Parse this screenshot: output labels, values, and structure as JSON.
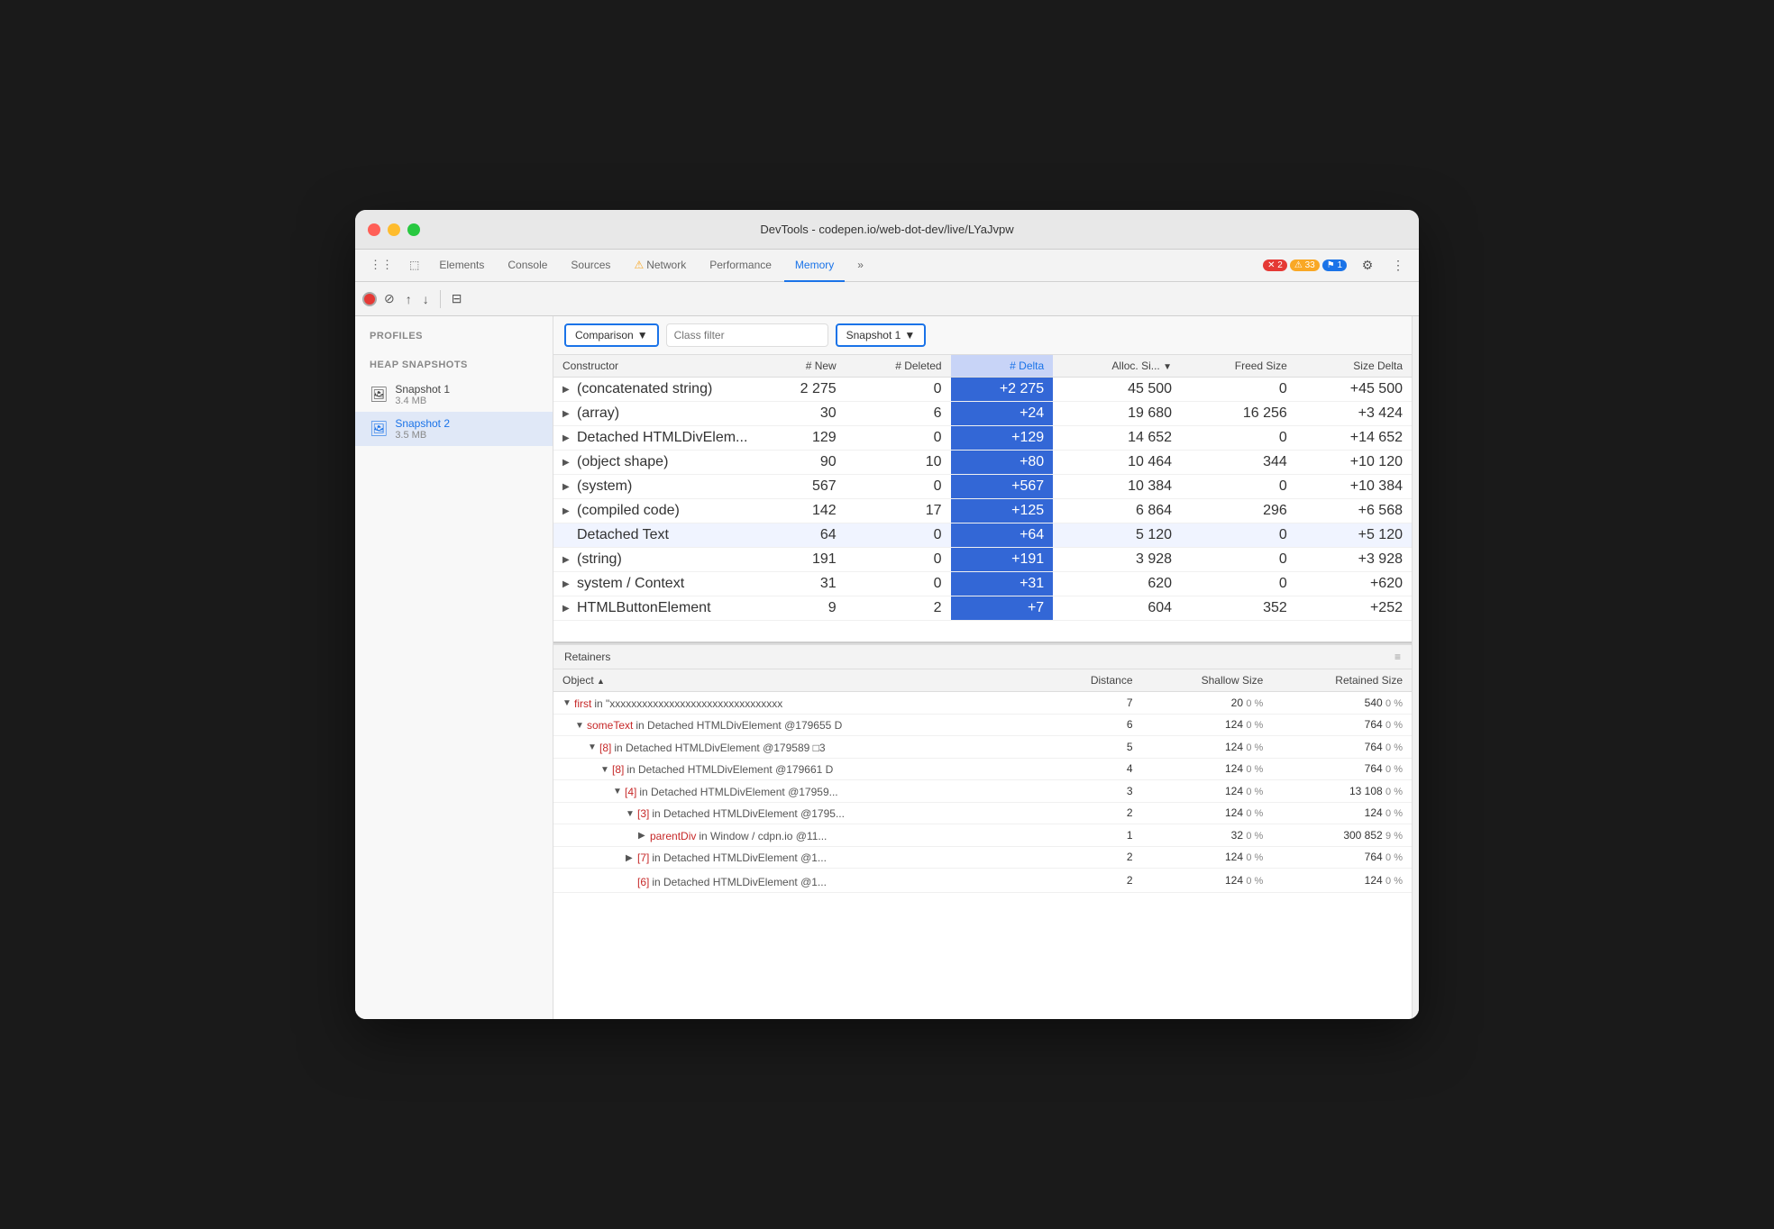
{
  "window": {
    "title": "DevTools - codepen.io/web-dot-dev/live/LYaJvpw"
  },
  "tabs": [
    {
      "label": "Elements",
      "icon": "",
      "active": false
    },
    {
      "label": "Console",
      "icon": "",
      "active": false
    },
    {
      "label": "Sources",
      "icon": "",
      "active": false
    },
    {
      "label": "Network",
      "icon": "⚠",
      "active": false
    },
    {
      "label": "Performance",
      "icon": "",
      "active": false
    },
    {
      "label": "Memory",
      "icon": "",
      "active": true
    },
    {
      "label": "»",
      "icon": "",
      "active": false
    }
  ],
  "badges": {
    "errors": "2",
    "warnings": "33",
    "info": "1"
  },
  "comparison_toolbar": {
    "mode_label": "Comparison",
    "filter_placeholder": "Class filter",
    "snapshot_label": "Snapshot 1"
  },
  "table_headers": {
    "constructor": "Constructor",
    "new": "# New",
    "deleted": "# Deleted",
    "delta": "# Delta",
    "alloc_size": "Alloc. Si...",
    "freed_size": "Freed Size",
    "size_delta": "Size Delta"
  },
  "table_rows": [
    {
      "constructor": "(concatenated string)",
      "new": "2 275",
      "deleted": "0",
      "delta": "+2 275",
      "alloc_size": "45 500",
      "freed_size": "0",
      "size_delta": "+45 500",
      "expandable": true
    },
    {
      "constructor": "(array)",
      "new": "30",
      "deleted": "6",
      "delta": "+24",
      "alloc_size": "19 680",
      "freed_size": "16 256",
      "size_delta": "+3 424",
      "expandable": true
    },
    {
      "constructor": "Detached HTMLDivElem...",
      "new": "129",
      "deleted": "0",
      "delta": "+129",
      "alloc_size": "14 652",
      "freed_size": "0",
      "size_delta": "+14 652",
      "expandable": true
    },
    {
      "constructor": "(object shape)",
      "new": "90",
      "deleted": "10",
      "delta": "+80",
      "alloc_size": "10 464",
      "freed_size": "344",
      "size_delta": "+10 120",
      "expandable": true
    },
    {
      "constructor": "(system)",
      "new": "567",
      "deleted": "0",
      "delta": "+567",
      "alloc_size": "10 384",
      "freed_size": "0",
      "size_delta": "+10 384",
      "expandable": true
    },
    {
      "constructor": "(compiled code)",
      "new": "142",
      "deleted": "17",
      "delta": "+125",
      "alloc_size": "6 864",
      "freed_size": "296",
      "size_delta": "+6 568",
      "expandable": true
    },
    {
      "constructor": "Detached Text",
      "new": "64",
      "deleted": "0",
      "delta": "+64",
      "alloc_size": "5 120",
      "freed_size": "0",
      "size_delta": "+5 120",
      "expandable": false
    },
    {
      "constructor": "(string)",
      "new": "191",
      "deleted": "0",
      "delta": "+191",
      "alloc_size": "3 928",
      "freed_size": "0",
      "size_delta": "+3 928",
      "expandable": true
    },
    {
      "constructor": "system / Context",
      "new": "31",
      "deleted": "0",
      "delta": "+31",
      "alloc_size": "620",
      "freed_size": "0",
      "size_delta": "+620",
      "expandable": true
    },
    {
      "constructor": "HTMLButtonElement",
      "new": "9",
      "deleted": "2",
      "delta": "+7",
      "alloc_size": "604",
      "freed_size": "352",
      "size_delta": "+252",
      "expandable": true
    }
  ],
  "retainers": {
    "header": "Retainers",
    "columns": {
      "object": "Object",
      "distance": "Distance",
      "shallow_size": "Shallow Size",
      "retained_size": "Retained Size"
    },
    "rows": [
      {
        "indent": 0,
        "prefix": "▼",
        "object_text": "first",
        "object_suffix": " in \"xxxxxxxxxxxxxxxxxxxxxxxxxxxxxxxx",
        "object_color": "red",
        "distance": "7",
        "shallow_size": "20",
        "shallow_pct": "0 %",
        "retained_size": "540",
        "retained_pct": "0 %"
      },
      {
        "indent": 1,
        "prefix": "▼",
        "object_text": "someText",
        "object_suffix": " in Detached HTMLDivElement @179655 D",
        "object_color": "red",
        "distance": "6",
        "shallow_size": "124",
        "shallow_pct": "0 %",
        "retained_size": "764",
        "retained_pct": "0 %"
      },
      {
        "indent": 2,
        "prefix": "▼",
        "object_text": "[8]",
        "object_suffix": " in Detached HTMLDivElement @179589 □3",
        "object_color": "red",
        "distance": "5",
        "shallow_size": "124",
        "shallow_pct": "0 %",
        "retained_size": "764",
        "retained_pct": "0 %"
      },
      {
        "indent": 3,
        "prefix": "▼",
        "object_text": "[8]",
        "object_suffix": " in Detached HTMLDivElement @179661 D",
        "object_color": "red",
        "distance": "4",
        "shallow_size": "124",
        "shallow_pct": "0 %",
        "retained_size": "764",
        "retained_pct": "0 %"
      },
      {
        "indent": 4,
        "prefix": "▼",
        "object_text": "[4]",
        "object_suffix": " in Detached HTMLDivElement @17959...",
        "object_color": "red",
        "distance": "3",
        "shallow_size": "124",
        "shallow_pct": "0 %",
        "retained_size": "13 108",
        "retained_pct": "0 %"
      },
      {
        "indent": 5,
        "prefix": "▼",
        "object_text": "[3]",
        "object_suffix": " in Detached HTMLDivElement @1795...",
        "object_color": "red",
        "distance": "2",
        "shallow_size": "124",
        "shallow_pct": "0 %",
        "retained_size": "124",
        "retained_pct": "0 %"
      },
      {
        "indent": 6,
        "prefix": "▶",
        "object_text": "parentDiv",
        "object_suffix": " in Window / cdpn.io @11...",
        "object_color": "red",
        "distance": "1",
        "shallow_size": "32",
        "shallow_pct": "0 %",
        "retained_size": "300 852",
        "retained_pct": "9 %"
      },
      {
        "indent": 5,
        "prefix": "▶",
        "object_text": "[7]",
        "object_suffix": " in Detached HTMLDivElement @1...",
        "object_color": "red",
        "distance": "2",
        "shallow_size": "124",
        "shallow_pct": "0 %",
        "retained_size": "764",
        "retained_pct": "0 %"
      },
      {
        "indent": 5,
        "prefix": "",
        "object_text": "[6]",
        "object_suffix": " in Detached HTMLDivElement @1...",
        "object_color": "red",
        "distance": "2",
        "shallow_size": "124",
        "shallow_pct": "0 %",
        "retained_size": "124",
        "retained_pct": "0 %"
      }
    ]
  },
  "sidebar": {
    "profiles_title": "Profiles",
    "heap_snapshots_title": "HEAP SNAPSHOTS",
    "snapshots": [
      {
        "name": "Snapshot 1",
        "size": "3.4 MB",
        "active": false
      },
      {
        "name": "Snapshot 2",
        "size": "3.5 MB",
        "active": true
      }
    ]
  },
  "colors": {
    "accent": "#1a73e8",
    "delta_bg": "#3367d6",
    "delta_text": "#ffffff",
    "red": "#c62828",
    "positive": "#1a73e8"
  }
}
